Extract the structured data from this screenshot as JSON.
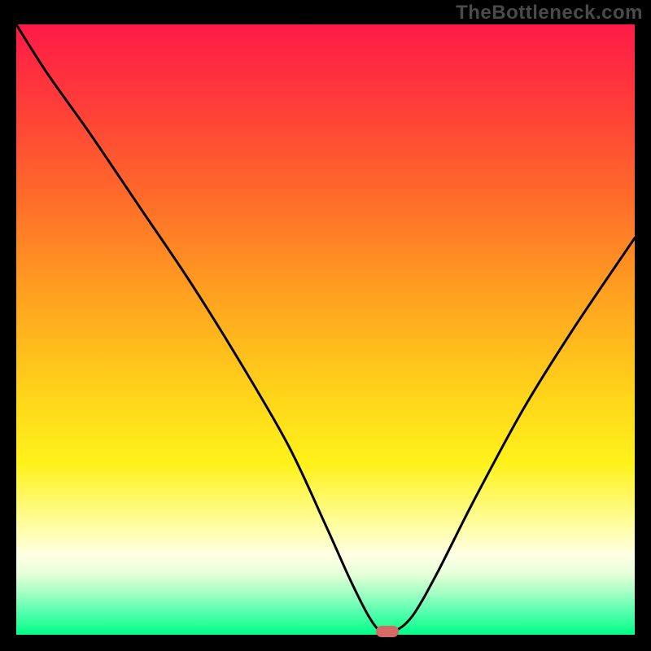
{
  "watermark": "TheBottleneck.com",
  "chart_data": {
    "type": "line",
    "title": "",
    "xlabel": "",
    "ylabel": "",
    "xlim": [
      0,
      100
    ],
    "ylim": [
      0,
      100
    ],
    "series": [
      {
        "name": "bottleneck-curve",
        "x": [
          0,
          5,
          12,
          20,
          28,
          36,
          44,
          50,
          54,
          57,
          59,
          61,
          64,
          68,
          74,
          82,
          90,
          100
        ],
        "y": [
          100,
          92,
          82,
          70,
          58,
          45,
          31,
          18,
          9,
          3,
          0.5,
          0.5,
          3,
          10,
          22,
          37,
          50,
          65
        ]
      }
    ],
    "marker": {
      "x": 60,
      "y": 0.5,
      "color": "#d46a63"
    },
    "gradient_stops": [
      {
        "pos": 0.0,
        "color": "#ff1a47"
      },
      {
        "pos": 0.12,
        "color": "#ff3a3a"
      },
      {
        "pos": 0.28,
        "color": "#ff6a2a"
      },
      {
        "pos": 0.44,
        "color": "#ffa020"
      },
      {
        "pos": 0.6,
        "color": "#ffd21a"
      },
      {
        "pos": 0.72,
        "color": "#fff21a"
      },
      {
        "pos": 0.82,
        "color": "#fffda0"
      },
      {
        "pos": 0.87,
        "color": "#ffffe5"
      },
      {
        "pos": 0.9,
        "color": "#e6ffd9"
      },
      {
        "pos": 0.93,
        "color": "#a6ffc4"
      },
      {
        "pos": 0.96,
        "color": "#5cffb0"
      },
      {
        "pos": 1.0,
        "color": "#00ff88"
      }
    ]
  }
}
